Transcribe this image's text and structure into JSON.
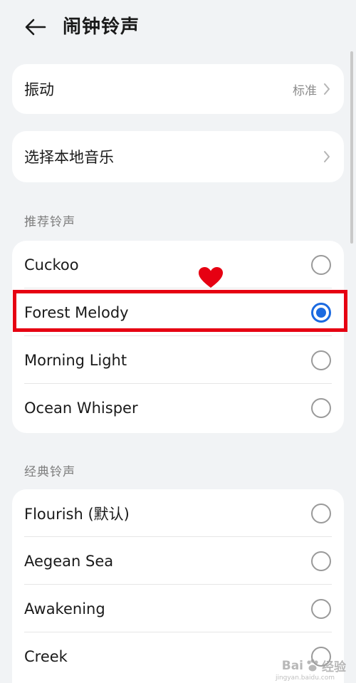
{
  "header": {
    "back_icon": "arrow-left-icon",
    "title": "闹钟铃声"
  },
  "settings": {
    "vibration": {
      "label": "振动",
      "value": "标准"
    },
    "local_music": {
      "label": "选择本地音乐"
    }
  },
  "recommended": {
    "section_label": "推荐铃声",
    "items": [
      {
        "label": "Cuckoo",
        "selected": false
      },
      {
        "label": "Forest Melody",
        "selected": true
      },
      {
        "label": "Morning Light",
        "selected": false
      },
      {
        "label": "Ocean Whisper",
        "selected": false
      }
    ]
  },
  "classic": {
    "section_label": "经典铃声",
    "items": [
      {
        "label": "Flourish (默认)",
        "selected": false
      },
      {
        "label": "Aegean Sea",
        "selected": false
      },
      {
        "label": "Awakening",
        "selected": false
      },
      {
        "label": "Creek",
        "selected": false
      }
    ]
  },
  "watermark": {
    "brand": "Bai",
    "brand_tail": "经验",
    "url": "jingyan.baidu.com"
  },
  "colors": {
    "accent": "#1b6ae0",
    "highlight": "#e60012",
    "background": "#f1f3f5"
  }
}
